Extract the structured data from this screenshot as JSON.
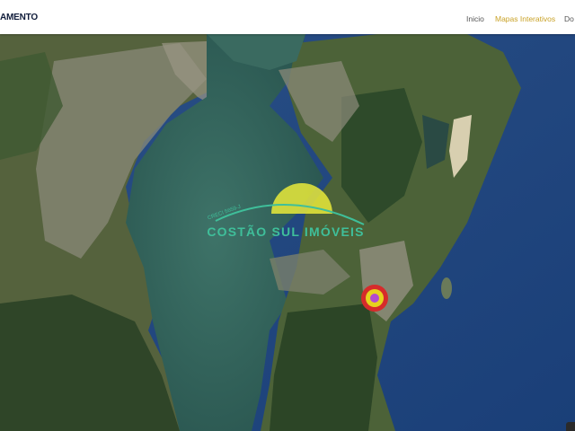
{
  "header": {
    "brand": "AMENTO",
    "nav": [
      {
        "label": "Inicio",
        "active": false
      },
      {
        "label": "Mapas Interativos",
        "active": true
      },
      {
        "label": "Do",
        "active": false
      }
    ]
  },
  "map": {
    "watermark_main": "COSTÃO SUL IMÓVEIS",
    "watermark_small": "CRECI 5659-J",
    "marker_icon": "location-marker-icon"
  },
  "colors": {
    "accent": "#c9a227",
    "watermark": "#3fbf9a",
    "marker_outer": "#d62b2b",
    "marker_ring": "#e6d31e",
    "marker_core": "#b24bd0"
  }
}
